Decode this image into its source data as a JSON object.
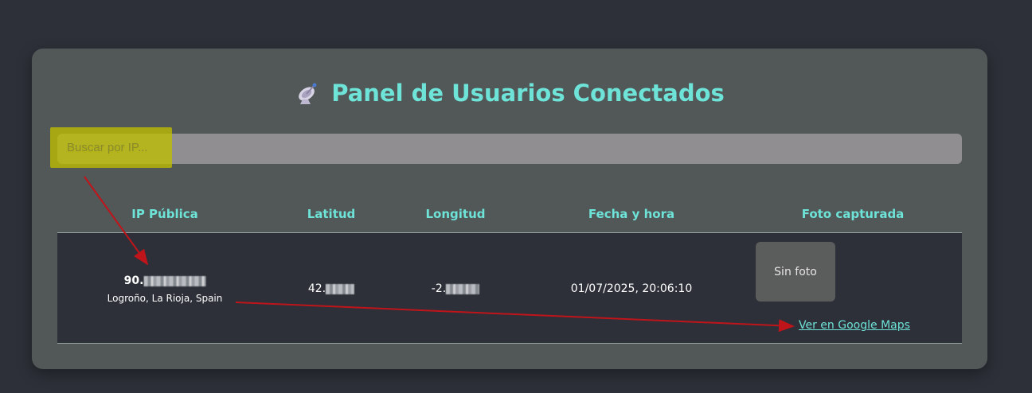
{
  "header": {
    "icon": "satellite-dish-icon",
    "title": "Panel de Usuarios Conectados"
  },
  "search": {
    "placeholder": "Buscar por IP..."
  },
  "table": {
    "columns": [
      "IP Pública",
      "Latitud",
      "Longitud",
      "Fecha y hora",
      "Foto capturada"
    ],
    "rows": [
      {
        "ip_visible_prefix": "90.",
        "location": "Logroño, La Rioja, Spain",
        "lat_visible_prefix": "42.",
        "lon_visible_prefix": "-2.",
        "datetime": "01/07/2025, 20:06:10",
        "photo_label": "Sin foto",
        "maps_link": "Ver en Google Maps"
      }
    ]
  },
  "colors": {
    "accent": "#6ee3d8",
    "panel": "#525757",
    "background": "#2d3038",
    "highlight": "#bebe00",
    "annotation_arrow": "#c0141b"
  }
}
